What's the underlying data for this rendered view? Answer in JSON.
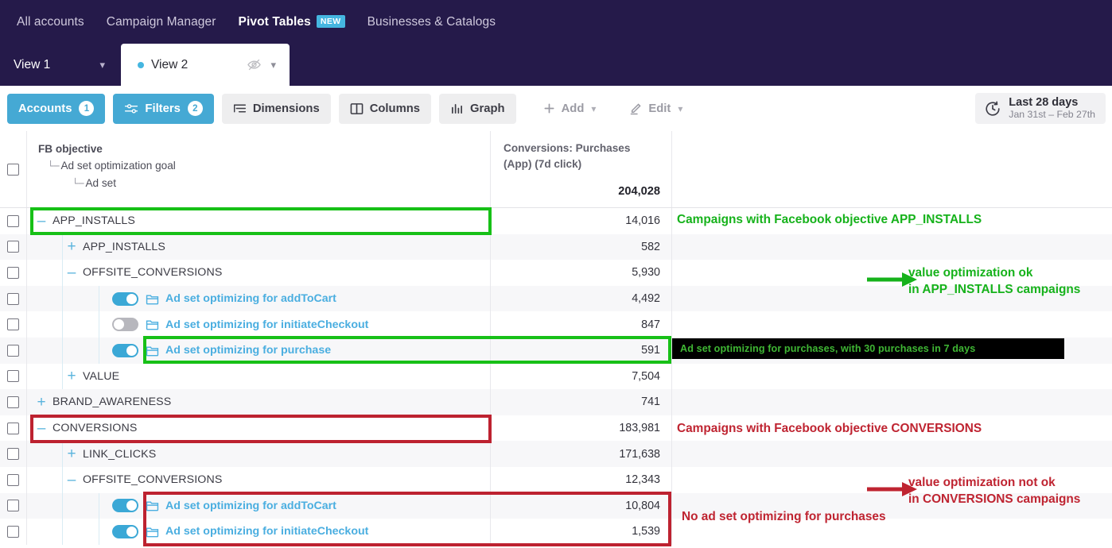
{
  "topnav": {
    "items": [
      {
        "label": "All accounts",
        "active": false,
        "badge": null
      },
      {
        "label": "Campaign Manager",
        "active": false,
        "badge": null
      },
      {
        "label": "Pivot Tables",
        "active": true,
        "badge": "NEW"
      },
      {
        "label": "Businesses & Catalogs",
        "active": false,
        "badge": null
      }
    ]
  },
  "views": {
    "tab1": {
      "label": "View 1"
    },
    "tab2": {
      "label": "View 2"
    }
  },
  "toolbar": {
    "accounts_label": "Accounts",
    "accounts_count": "1",
    "filters_label": "Filters",
    "filters_count": "2",
    "dimensions_label": "Dimensions",
    "columns_label": "Columns",
    "graph_label": "Graph",
    "add_label": "Add",
    "edit_label": "Edit",
    "date_main": "Last 28 days",
    "date_sub": "Jan 31st – Feb 27th"
  },
  "table": {
    "dimension_header": {
      "level0": "FB objective",
      "level1": "Ad set optimization goal",
      "level2": "Ad set"
    },
    "metric_header": {
      "name_line1": "Conversions: Purchases",
      "name_line2": "(App) (7d click)",
      "total": "204,028"
    },
    "rows": [
      {
        "label": "APP_INSTALLS",
        "value": "14,016",
        "depth": 0,
        "expander": "minus",
        "type": "group"
      },
      {
        "label": "APP_INSTALLS",
        "value": "582",
        "depth": 1,
        "expander": "plus",
        "type": "group"
      },
      {
        "label": "OFFSITE_CONVERSIONS",
        "value": "5,930",
        "depth": 1,
        "expander": "minus",
        "type": "group"
      },
      {
        "label": "Ad set optimizing for addToCart",
        "value": "4,492",
        "depth": 2,
        "expander": "none",
        "type": "adset",
        "toggle": "on"
      },
      {
        "label": "Ad set optimizing for initiateCheckout",
        "value": "847",
        "depth": 2,
        "expander": "none",
        "type": "adset",
        "toggle": "off"
      },
      {
        "label": "Ad set optimizing for purchase",
        "value": "591",
        "depth": 2,
        "expander": "none",
        "type": "adset",
        "toggle": "on"
      },
      {
        "label": "VALUE",
        "value": "7,504",
        "depth": 1,
        "expander": "plus",
        "type": "group"
      },
      {
        "label": "BRAND_AWARENESS",
        "value": "741",
        "depth": 0,
        "expander": "plus",
        "type": "group"
      },
      {
        "label": "CONVERSIONS",
        "value": "183,981",
        "depth": 0,
        "expander": "minus",
        "type": "group"
      },
      {
        "label": "LINK_CLICKS",
        "value": "171,638",
        "depth": 1,
        "expander": "plus",
        "type": "group"
      },
      {
        "label": "OFFSITE_CONVERSIONS",
        "value": "12,343",
        "depth": 1,
        "expander": "minus",
        "type": "group"
      },
      {
        "label": "Ad set optimizing for addToCart",
        "value": "10,804",
        "depth": 2,
        "expander": "none",
        "type": "adset",
        "toggle": "on"
      },
      {
        "label": "Ad set optimizing for initiateCheckout",
        "value": "1,539",
        "depth": 2,
        "expander": "none",
        "type": "adset",
        "toggle": "on"
      }
    ]
  },
  "annotations": {
    "green_app_installs": "Campaigns with Facebook objective APP_INSTALLS",
    "green_value_opt_l1": "value optimization ok",
    "green_value_opt_l2": "in APP_INSTALLS campaigns",
    "black_callout": "Ad set optimizing for purchases, with 30 purchases in 7 days",
    "red_conversions": "Campaigns with Facebook objective CONVERSIONS",
    "red_value_opt_l1": "value optimization not ok",
    "red_value_opt_l2": "in CONVERSIONS campaigns",
    "red_no_adset": "No ad set optimizing for purchases"
  },
  "colors": {
    "nav_purple": "#251a4a",
    "accent_blue": "#45a9d4",
    "green": "#17c017",
    "red": "#bd2230"
  }
}
